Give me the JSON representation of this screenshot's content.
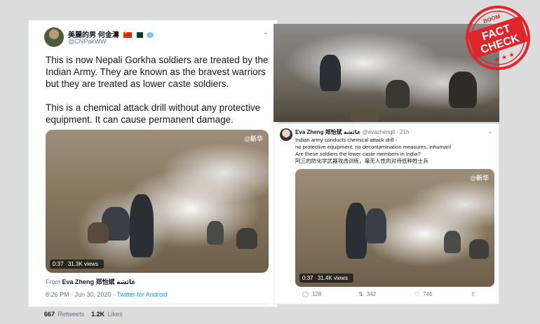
{
  "left_tweet": {
    "display_name": "美麗的男 何金濤",
    "handle": "@CNPakWW",
    "text_para1": "This is now Nepali Gorkha soldiers are treated by the Indian Army. They are known as the bravest warriors but they are treated as lower caste soldiers.",
    "text_para2": "This is a chemical attack drill without any protective equipment. It can cause permanent damage.",
    "video_duration": "0:37",
    "video_views": "31.3K views",
    "source_prefix": "From",
    "source_name": "Eva Zheng 郑怡斌 عائشة",
    "timestamp": "8:26 PM · Jun 30, 2020 ·",
    "client": "Twitter for Android",
    "retweets_count": "667",
    "retweets_label": "Retweets",
    "likes_count": "1.2K",
    "likes_label": "Likes",
    "watermark": "@新华"
  },
  "right_tweet": {
    "display_name": "Eva Zheng 郑怡斌 عائشة",
    "handle": "@evazhengll",
    "time": "· 21h",
    "line1": "Indian army conducts chemical attack drill -",
    "line2": "no protective equipment, no decontamination measures, inhuman!",
    "line3": "Are these soldiers the lower caste members in India?",
    "line4": "阿三的防化学武器攻击训练，毫无人性的对待低种姓士兵",
    "video_duration": "0:37",
    "video_views": "31.4K views",
    "replies": "128",
    "retweets": "342",
    "likes": "746",
    "watermark": "@新华"
  },
  "stamp": {
    "top": "BOOM",
    "line1": "FACT",
    "line2": "CHECK",
    "stars": "★ ★ ★",
    "color": "#e0252b"
  },
  "colors": {
    "link": "#1b95e0",
    "text": "#14171a",
    "muted": "#657786"
  }
}
